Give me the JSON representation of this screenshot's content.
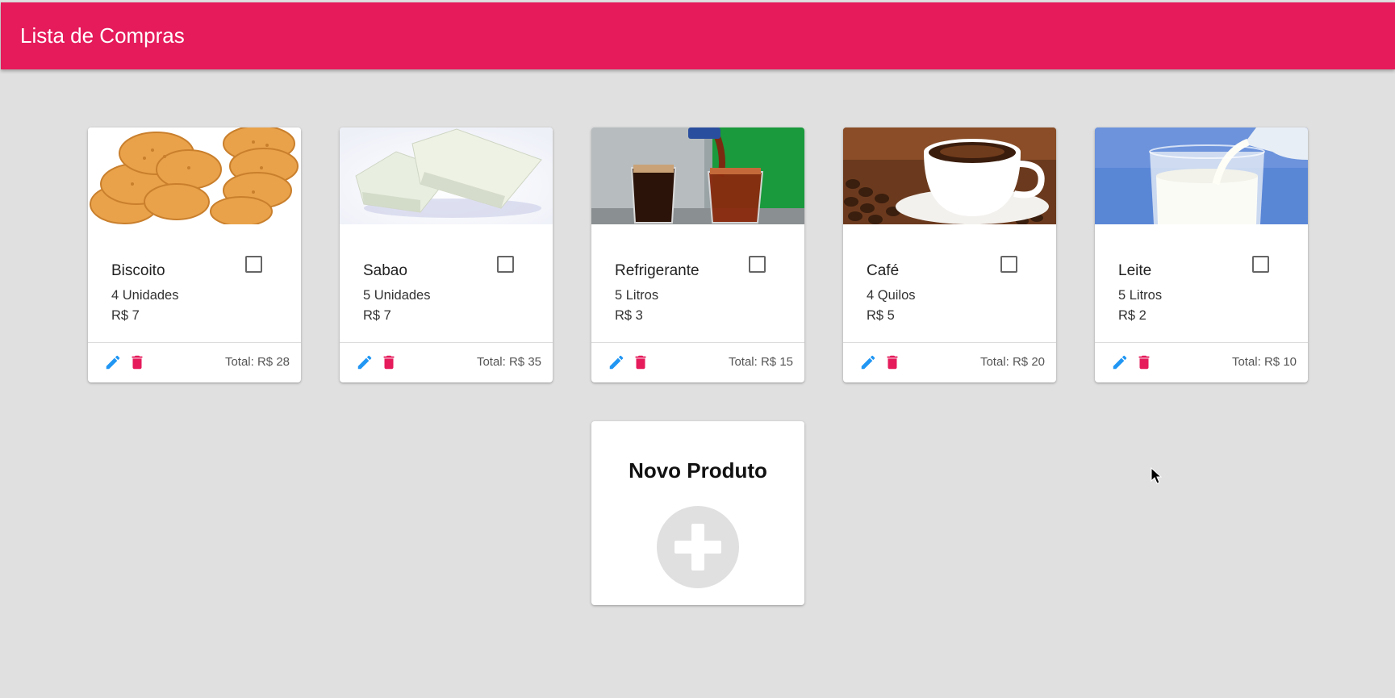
{
  "app": {
    "title": "Lista de Compras"
  },
  "colors": {
    "primary": "#e51b5b",
    "edit": "#2196f3",
    "delete": "#e51b5b"
  },
  "products": [
    {
      "name": "Biscoito",
      "quantity": "4 Unidades",
      "price": "R$ 7",
      "total": "Total: R$ 28",
      "checked": false,
      "image": "crackers"
    },
    {
      "name": "Sabao",
      "quantity": "5 Unidades",
      "price": "R$ 7",
      "total": "Total: R$ 35",
      "checked": false,
      "image": "soap-bars"
    },
    {
      "name": "Refrigerante",
      "quantity": "5 Litros",
      "price": "R$ 3",
      "total": "Total: R$ 15",
      "checked": false,
      "image": "soda-glasses"
    },
    {
      "name": "Café",
      "quantity": "4 Quilos",
      "price": "R$ 5",
      "total": "Total: R$ 20",
      "checked": false,
      "image": "coffee-cup"
    },
    {
      "name": "Leite",
      "quantity": "5 Litros",
      "price": "R$ 2",
      "total": "Total: R$ 10",
      "checked": false,
      "image": "milk-glass"
    }
  ],
  "new_product": {
    "title": "Novo Produto",
    "icon": "plus-icon"
  },
  "icons": {
    "edit": "pencil-icon",
    "delete": "trash-icon",
    "cursor": "mouse-pointer-icon"
  }
}
